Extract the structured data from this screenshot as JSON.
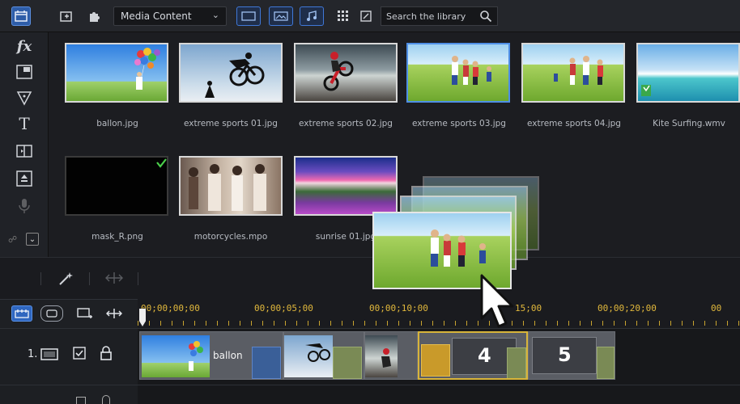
{
  "toolbar": {
    "dropdown_value": "Media Content",
    "search_placeholder": "Search the library"
  },
  "library": {
    "items": [
      {
        "label": "ballon.jpg"
      },
      {
        "label": "extreme sports 01.jpg"
      },
      {
        "label": "extreme sports 02.jpg"
      },
      {
        "label": "extreme sports 03.jpg"
      },
      {
        "label": "extreme sports 04.jpg"
      },
      {
        "label": "Kite Surfing.wmv"
      },
      {
        "label": "mask_R.png"
      },
      {
        "label": "motorcycles.mpo"
      },
      {
        "label": "sunrise 01.jpg"
      }
    ]
  },
  "timeline": {
    "ruler": [
      "00;00;00;00",
      "00;00;05;00",
      "00;00;10;00",
      "15;00",
      "00;00;20;00",
      "00"
    ],
    "track1_label": "1.",
    "clip_text": "ballon",
    "clip_num_4": "4",
    "clip_num_5": "5"
  },
  "colors": {
    "accent": "#2e5da8",
    "ruler": "#e1b83c",
    "selection": "#d8b43a"
  }
}
